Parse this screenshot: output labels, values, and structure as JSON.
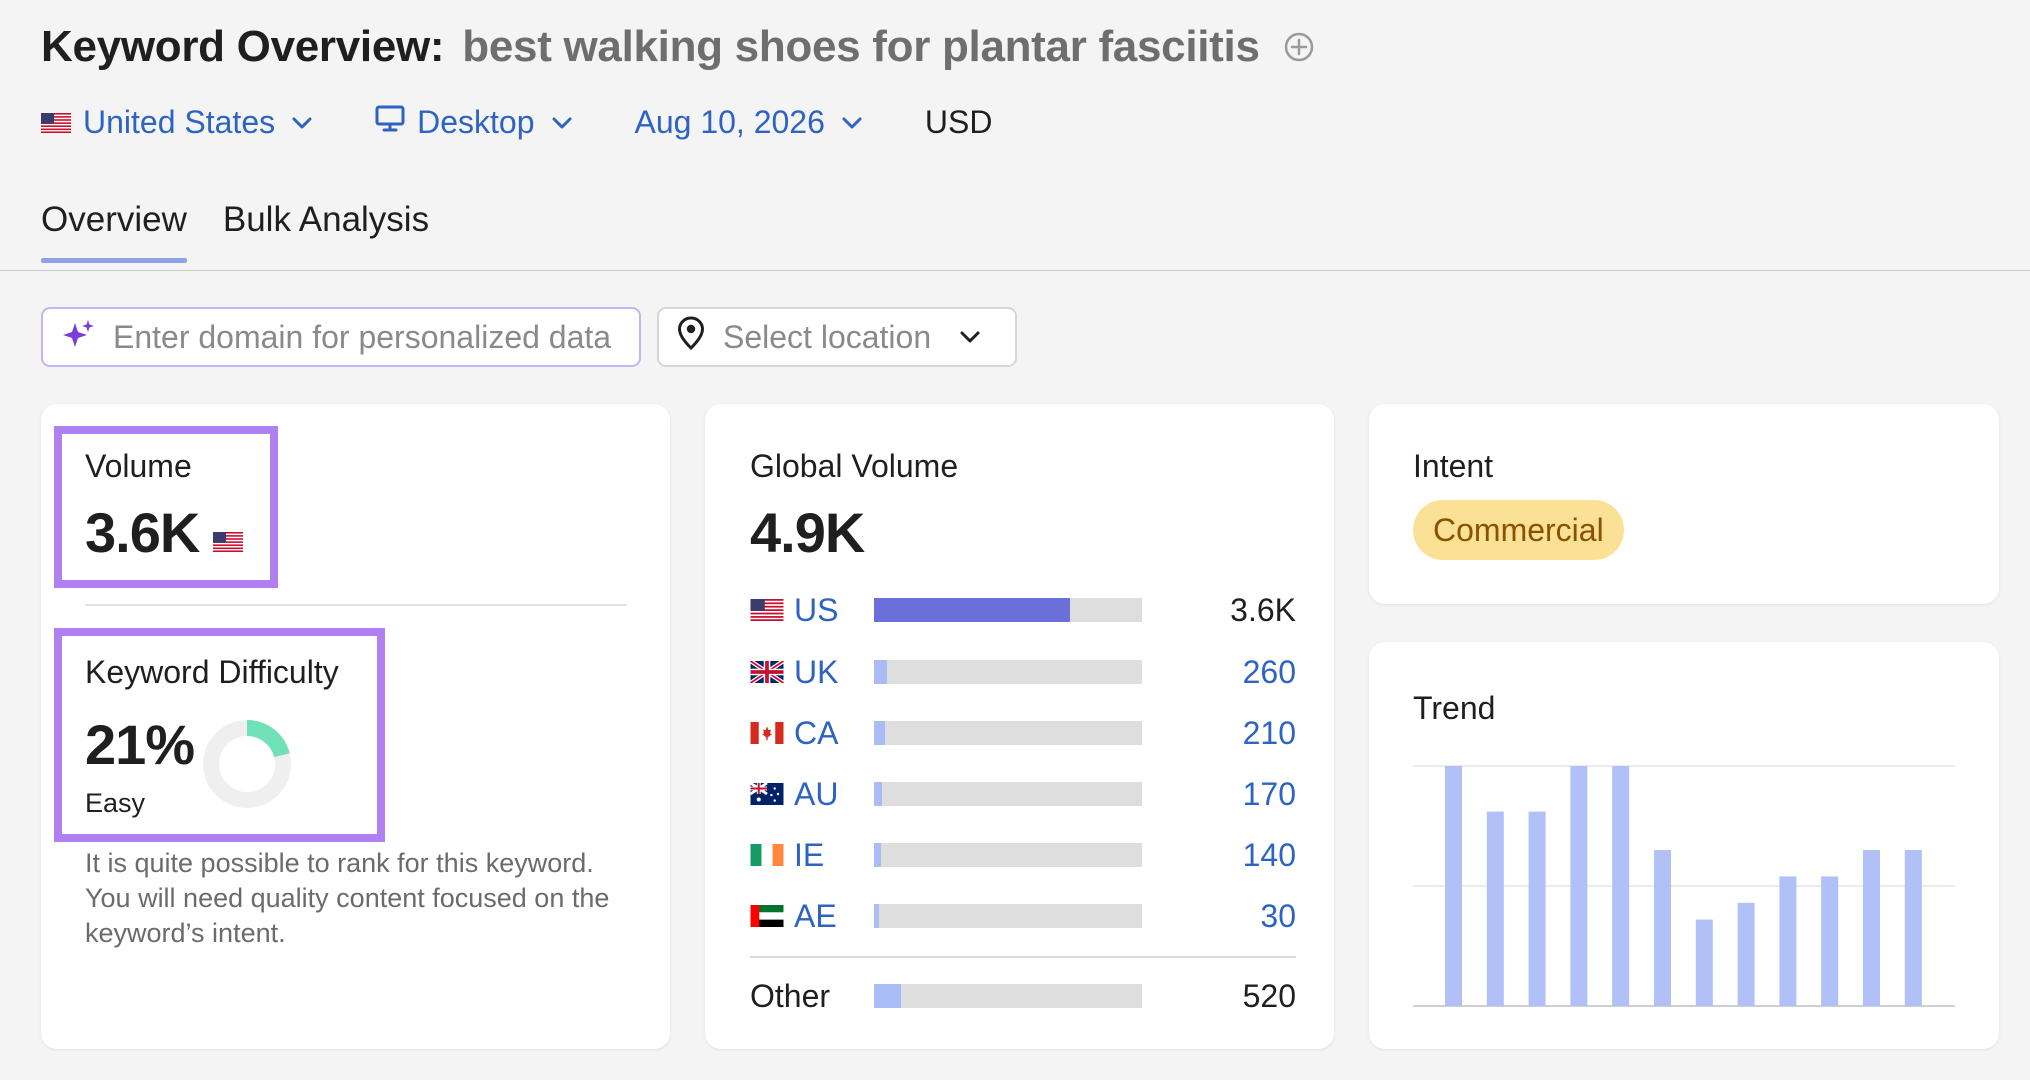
{
  "header": {
    "title_label": "Keyword Overview:",
    "keyword": "best walking shoes for plantar fasciitis",
    "add_icon": "add-circle-icon"
  },
  "filters": {
    "country": "United States",
    "device": "Desktop",
    "date": "Aug 10, 2026",
    "currency": "USD"
  },
  "tabs": [
    {
      "label": "Overview",
      "active": true
    },
    {
      "label": "Bulk Analysis",
      "active": false
    }
  ],
  "domain_input": {
    "placeholder": "Enter domain for personalized data",
    "value": ""
  },
  "location_select": {
    "placeholder": "Select location"
  },
  "volume": {
    "label": "Volume",
    "value": "3.6K"
  },
  "keyword_difficulty": {
    "label": "Keyword Difficulty",
    "value": "21%",
    "percent": 21,
    "level": "Easy",
    "description": "It is quite possible to rank for this keyword. You will need quality content focused on the keyword’s intent."
  },
  "global_volume": {
    "label": "Global Volume",
    "value": "4.9K",
    "countries": [
      {
        "code": "US",
        "value": "3.6K",
        "share": 0.73
      },
      {
        "code": "UK",
        "value": "260",
        "share": 0.05
      },
      {
        "code": "CA",
        "value": "210",
        "share": 0.04
      },
      {
        "code": "AU",
        "value": "170",
        "share": 0.03
      },
      {
        "code": "IE",
        "value": "140",
        "share": 0.025
      },
      {
        "code": "AE",
        "value": "30",
        "share": 0.02
      }
    ],
    "other": {
      "label": "Other",
      "value": "520",
      "share": 0.1
    }
  },
  "intent": {
    "label": "Intent",
    "value": "Commercial"
  },
  "trend": {
    "label": "Trend",
    "values": [
      100,
      81,
      81,
      100,
      100,
      65,
      36,
      43,
      54,
      54,
      65,
      65
    ]
  },
  "colors": {
    "link": "#2e63c2",
    "highlight": "#b07ff0",
    "volume_bar_primary": "#6a6fd9",
    "volume_bar_light": "#a9bcf5",
    "kd_donut": "#6fe0b8",
    "trend_bar": "#b1c0f6",
    "intent_badge_bg": "#fbe195",
    "intent_badge_text": "#8a5200"
  }
}
